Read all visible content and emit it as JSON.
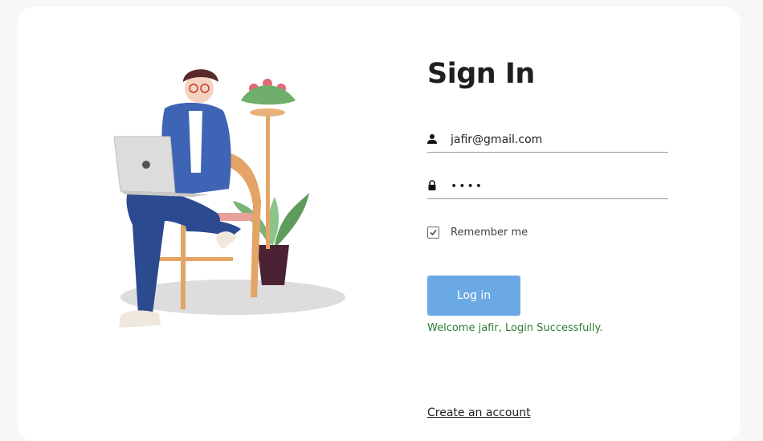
{
  "login": {
    "title": "Sign In",
    "email_value": "jafir@gmail.com",
    "password_value": "••••",
    "remember_label": "Remember me",
    "remember_checked": true,
    "login_button": "Log in",
    "status_message": "Welcome jafir, Login Successfully.",
    "create_account": "Create an account"
  },
  "icons": {
    "email": "user-icon",
    "password": "lock-icon",
    "checkbox": "check-icon"
  },
  "colors": {
    "button_bg": "#6aa9e3",
    "status_text": "#2e7d32",
    "page_bg": "#f7f7f7"
  }
}
